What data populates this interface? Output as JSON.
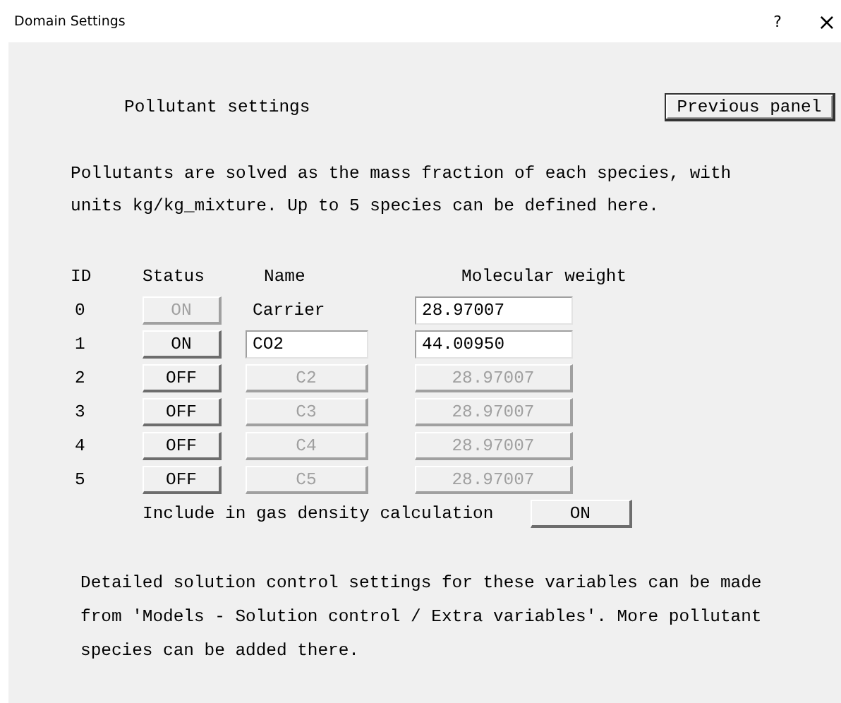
{
  "window": {
    "title": "Domain Settings",
    "help": "?",
    "close": "×"
  },
  "heading": "Pollutant settings",
  "previous_button": "Previous panel",
  "intro": "Pollutants are solved as the mass fraction of each species, with units kg/kg_mixture. Up to 5 species can be defined here.",
  "columns": [
    "ID",
    "Status",
    "Name",
    "Molecular weight"
  ],
  "rows": [
    {
      "id": "0",
      "status": "ON",
      "status_disabled": true,
      "name": "Carrier",
      "kind": "label",
      "name_disabled": false,
      "weight": "28.97007",
      "weight_disabled": false
    },
    {
      "id": "1",
      "status": "ON",
      "status_disabled": false,
      "name": "CO2",
      "kind": "field",
      "name_disabled": false,
      "weight": "44.00950",
      "weight_disabled": false
    },
    {
      "id": "2",
      "status": "OFF",
      "status_disabled": false,
      "name": "C2",
      "kind": "field",
      "name_disabled": true,
      "weight": "28.97007",
      "weight_disabled": true
    },
    {
      "id": "3",
      "status": "OFF",
      "status_disabled": false,
      "name": "C3",
      "kind": "field",
      "name_disabled": true,
      "weight": "28.97007",
      "weight_disabled": true
    },
    {
      "id": "4",
      "status": "OFF",
      "status_disabled": false,
      "name": "C4",
      "kind": "field",
      "name_disabled": true,
      "weight": "28.97007",
      "weight_disabled": true
    },
    {
      "id": "5",
      "status": "OFF",
      "status_disabled": false,
      "name": "C5",
      "kind": "field",
      "name_disabled": true,
      "weight": "28.97007",
      "weight_disabled": true
    }
  ],
  "density": {
    "label": "Include in gas density calculation",
    "button": "ON"
  },
  "note": "Detailed solution control settings for these variables can be made from 'Models - Solution control / Extra variables'. More pollutant species can be added there."
}
